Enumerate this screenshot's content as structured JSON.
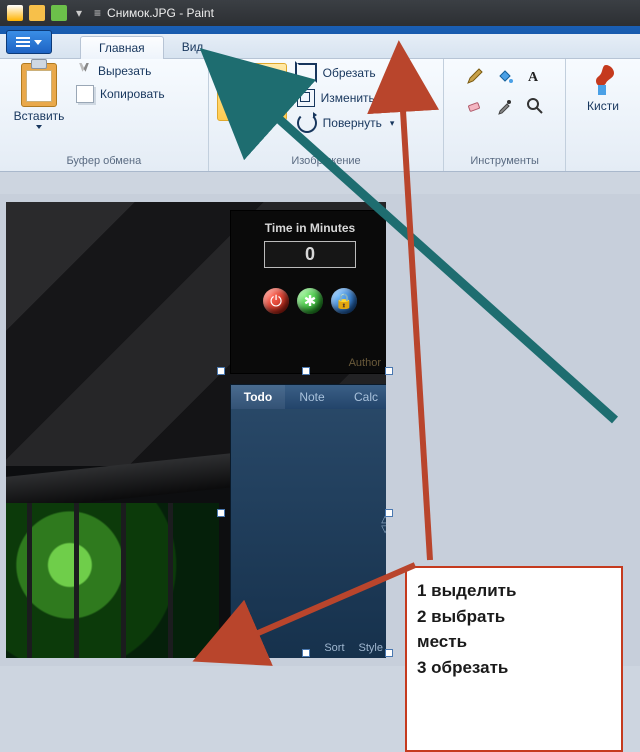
{
  "title": "Снимок.JPG - Paint",
  "tabs": {
    "home": "Главная",
    "view": "Вид"
  },
  "clipboard": {
    "paste": "Вставить",
    "cut": "Вырезать",
    "copy": "Копировать",
    "group": "Буфер обмена"
  },
  "image": {
    "select": "Выдели",
    "crop": "Обрезать",
    "resize": "Изменить",
    "rotate": "Повернуть",
    "group": "Изображение"
  },
  "tools": {
    "group": "Инструменты"
  },
  "brushes": {
    "label": "Кисти"
  },
  "gadget": {
    "title": "Time in Minutes",
    "value": "0",
    "author": "Author",
    "power": "⏻",
    "star": "✱",
    "lock": "🔒"
  },
  "widget": {
    "todo": "Todo",
    "note": "Note",
    "calc": "Calc",
    "sort": "Sort",
    "style": "Style"
  },
  "annotation": {
    "line1": "1 выделить",
    "line2": "2 выбрать",
    "line3": "месть",
    "line4": "3 обрезать"
  }
}
